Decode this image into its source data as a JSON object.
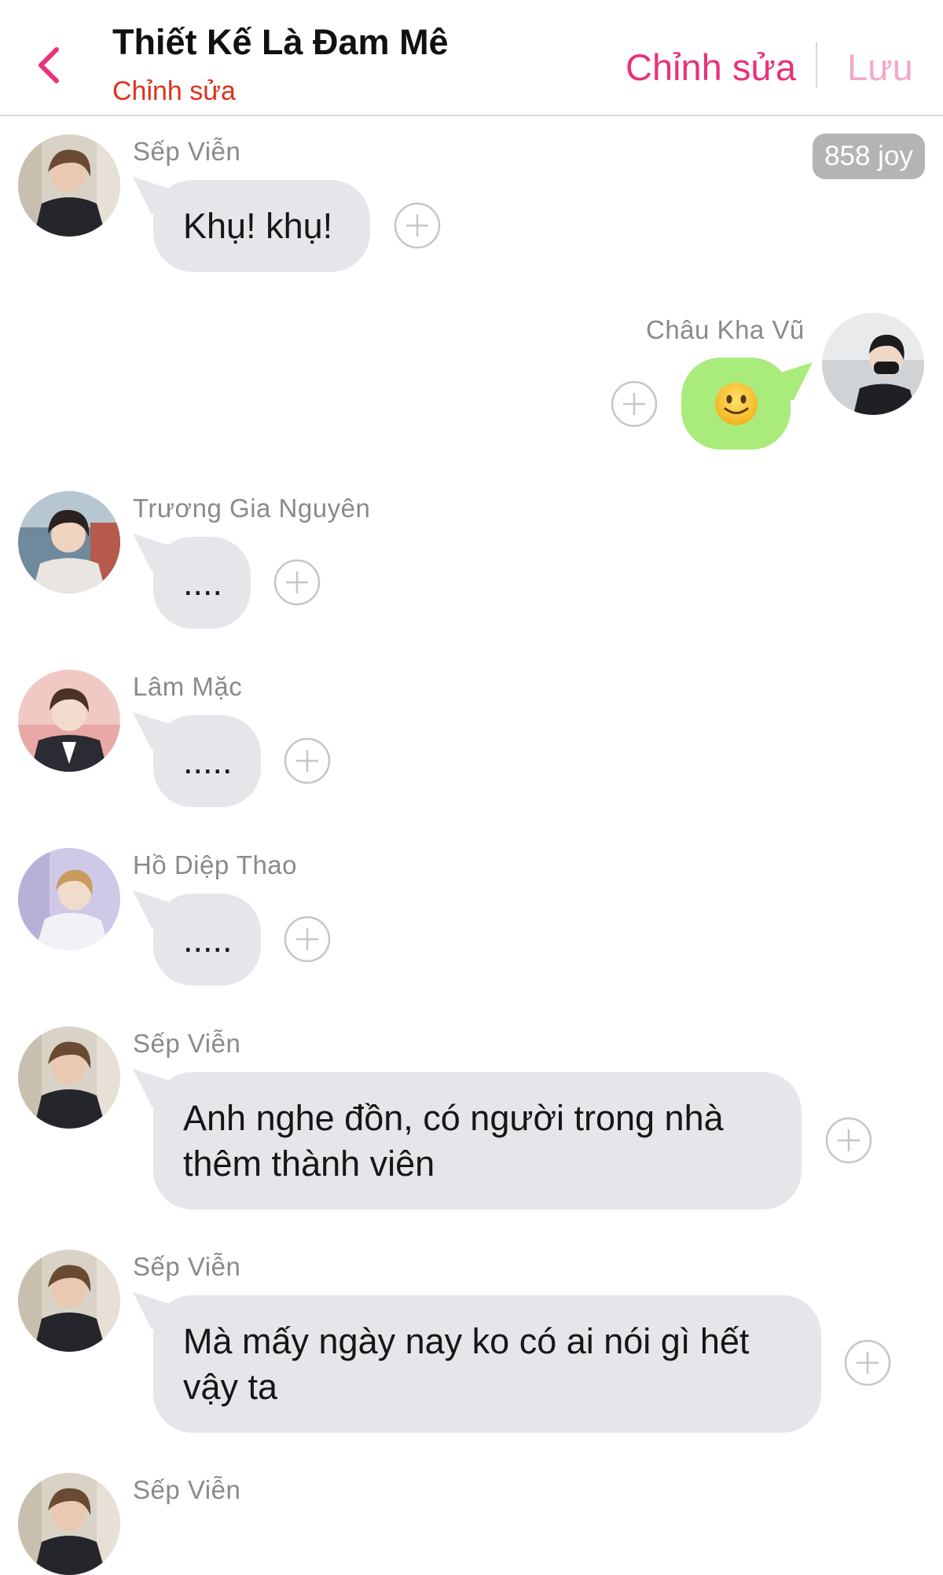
{
  "header": {
    "title": "Thiết Kế Là Đam Mê",
    "subtitle": "Chỉnh sửa",
    "edit_label": "Chỉnh sửa",
    "save_label": "Lưu"
  },
  "joy_badge": "858 joy",
  "messages": [
    {
      "sender": "Sếp Viễn",
      "side": "left",
      "lines": [
        "Khụ! khụ!"
      ]
    },
    {
      "sender": "Châu Kha Vũ",
      "side": "right",
      "content": "smiling-face-emoji"
    },
    {
      "sender": "Trương Gia Nguyên",
      "side": "left",
      "lines": [
        "...."
      ]
    },
    {
      "sender": "Lâm Mặc",
      "side": "left",
      "lines": [
        "....."
      ]
    },
    {
      "sender": "Hồ Diệp Thao",
      "side": "left",
      "lines": [
        "....."
      ]
    },
    {
      "sender": "Sếp Viễn",
      "side": "left",
      "lines": [
        "Anh nghe đồn, có người trong nhà",
        "thêm thành viên"
      ]
    },
    {
      "sender": "Sếp Viễn",
      "side": "left",
      "lines": [
        "Mà mấy ngày nay ko có ai nói gì hết",
        "vậy ta"
      ]
    },
    {
      "sender": "Sếp Viễn",
      "side": "left",
      "lines": []
    }
  ],
  "colors": {
    "accent": "#e8327b",
    "save_disabled": "#f3a9c8",
    "subtitle": "#e0311b",
    "bubble_incoming": "#e4e6ea",
    "bubble_outgoing": "#a9ec7c",
    "badge": "#b4b4b6"
  },
  "icons": {
    "back": "chevron-left-icon",
    "add_reaction": "plus-circle-icon",
    "emoji": "smiling-face-emoji"
  }
}
